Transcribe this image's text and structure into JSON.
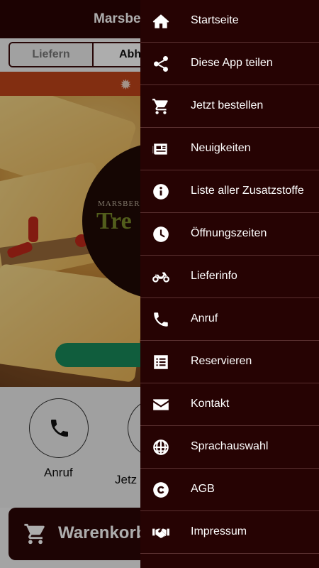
{
  "header": {
    "title": "Marsbe"
  },
  "order_mode": {
    "options": [
      "Liefern",
      "Abho"
    ],
    "selected": "Abho"
  },
  "hero": {
    "logo_small": "MARSBERG",
    "logo_big": "Tre"
  },
  "contacts": [
    {
      "label": "Anruf",
      "icon": "phone-icon"
    },
    {
      "label": "Jetz",
      "icon": "cart-icon"
    }
  ],
  "cart": {
    "label": "Warenkorb",
    "icon": "cart-icon"
  },
  "drawer": {
    "items": [
      {
        "label": "Startseite",
        "icon": "home-icon"
      },
      {
        "label": "Diese App teilen",
        "icon": "share-icon"
      },
      {
        "label": "Jetzt bestellen",
        "icon": "cart-icon"
      },
      {
        "label": "Neuigkeiten",
        "icon": "newspaper-icon"
      },
      {
        "label": "Liste aller Zusatzstoffe",
        "icon": "info-icon"
      },
      {
        "label": "Öffnungszeiten",
        "icon": "clock-icon"
      },
      {
        "label": "Lieferinfo",
        "icon": "motorcycle-icon"
      },
      {
        "label": "Anruf",
        "icon": "phone-icon"
      },
      {
        "label": "Reservieren",
        "icon": "list-icon"
      },
      {
        "label": "Kontakt",
        "icon": "envelope-icon"
      },
      {
        "label": "Sprachauswahl",
        "icon": "globe-icon"
      },
      {
        "label": "AGB",
        "icon": "copyright-icon"
      },
      {
        "label": "Impressum",
        "icon": "handshake-icon"
      }
    ]
  },
  "colors": {
    "drawer_bg": "#260303",
    "header_bg": "#2a0404",
    "accent_orange": "#c0441a",
    "accent_green": "#198a5b"
  }
}
